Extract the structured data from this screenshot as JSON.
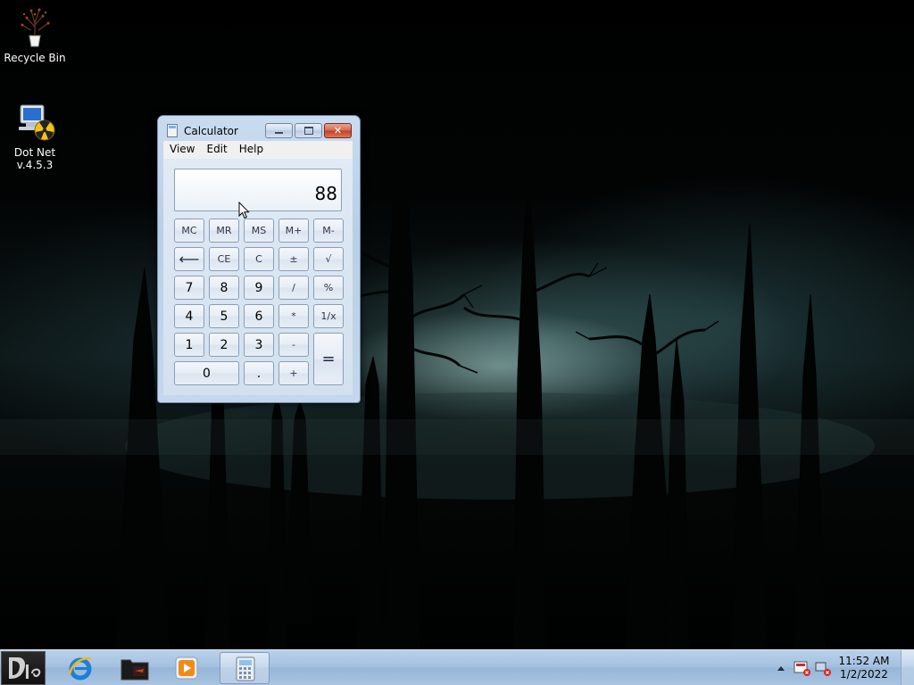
{
  "desktop": {
    "icons": [
      {
        "label": "Recycle Bin",
        "icon": "recycle-bin-icon"
      },
      {
        "label": "Dot Net\nv.4.5.3",
        "label_line1": "Dot Net",
        "label_line2": "v.4.5.3",
        "icon": "installer-icon"
      }
    ]
  },
  "calculator": {
    "title": "Calculator",
    "menu": [
      "View",
      "Edit",
      "Help"
    ],
    "display": "88",
    "keys": {
      "mc": "MC",
      "mr": "MR",
      "ms": "MS",
      "mplus": "M+",
      "mminus": "M-",
      "back": "⟵",
      "ce": "CE",
      "c": "C",
      "plusminus": "±",
      "sqrt": "√",
      "k7": "7",
      "k8": "8",
      "k9": "9",
      "div": "/",
      "pct": "%",
      "k4": "4",
      "k5": "5",
      "k6": "6",
      "mul": "*",
      "recip": "1/x",
      "k1": "1",
      "k2": "2",
      "k3": "3",
      "sub": "-",
      "eq": "=",
      "k0": "0",
      "dot": ".",
      "add": "+"
    }
  },
  "taskbar": {
    "pinned": [
      "start-button",
      "internet-explorer",
      "file-explorer",
      "media-player",
      "calculator"
    ],
    "active": "calculator",
    "clock": {
      "time": "11:52 AM",
      "date": "1/2/2022"
    }
  }
}
